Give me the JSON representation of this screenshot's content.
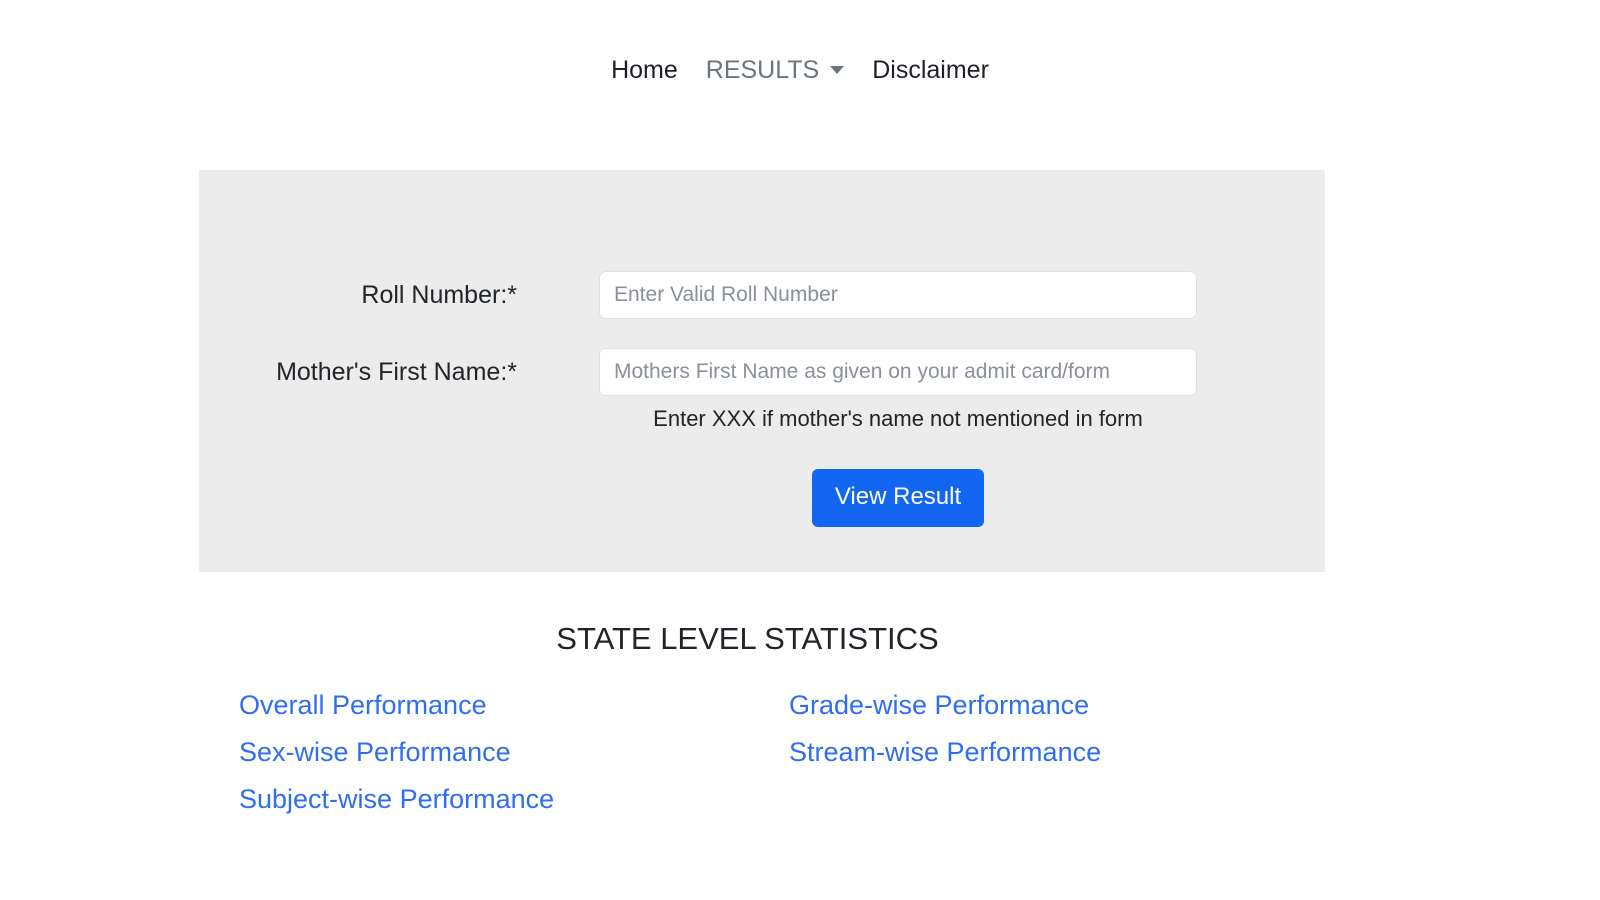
{
  "nav": {
    "items": [
      {
        "label": "Home",
        "muted": false,
        "has_caret": false
      },
      {
        "label": "RESULTS",
        "muted": true,
        "has_caret": true
      },
      {
        "label": "Disclaimer",
        "muted": false,
        "has_caret": false
      }
    ]
  },
  "form": {
    "roll_label": "Roll Number:*",
    "roll_placeholder": "Enter Valid Roll Number",
    "roll_value": "",
    "mother_label": "Mother's First Name:*",
    "mother_placeholder": "Mothers First Name as given on your admit card/form",
    "mother_value": "",
    "help_text": "Enter XXX if mother's name not mentioned in form",
    "submit_label": "View Result"
  },
  "statistics": {
    "title": "STATE LEVEL STATISTICS",
    "left_links": [
      "Overall Performance",
      "Sex-wise Performance",
      "Subject-wise Performance"
    ],
    "right_links": [
      "Grade-wise Performance",
      "Stream-wise Performance"
    ]
  },
  "colors": {
    "panel_background": "#ececec",
    "primary_button": "#1266f1",
    "link_blue": "#2f6fed",
    "muted_nav": "#6c757d",
    "text": "#212529"
  }
}
